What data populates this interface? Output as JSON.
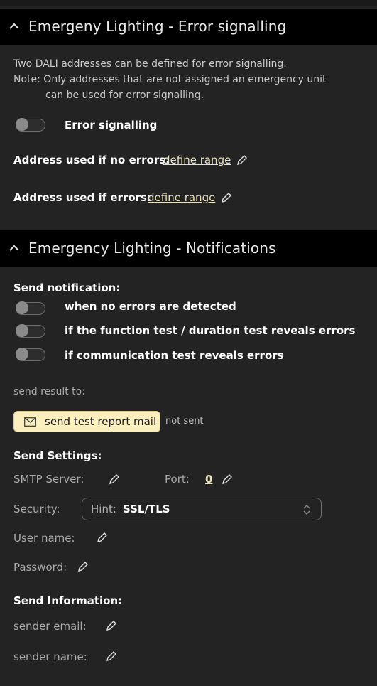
{
  "section1": {
    "title": "Emergeny Lighting - Error signalling",
    "desc_line1": "Two DALI addresses can be defined for error signalling.",
    "desc_line2": "Note: Only addresses that are not assigned an emergency unit",
    "desc_line3": "can be used for error signalling.",
    "toggle_label": "Error signalling",
    "addr_no_errors_label": "Address used if no errors:",
    "addr_no_errors_value": "define range",
    "addr_errors_label": "Address used if errors:",
    "addr_errors_value": "define range"
  },
  "section2": {
    "title": "Emergency Lighting -  Notifications",
    "send_notification_label": "Send notification:",
    "notify_options": [
      "when no errors are detected",
      "if the function test / duration test reveals errors",
      "if communication test reveals errors"
    ],
    "send_result_to": "send result to:",
    "mail_button": "send test report mail",
    "mail_status": "not sent",
    "send_settings_label": "Send Settings:",
    "smtp_server_label": "SMTP Server:",
    "port_label": "Port:",
    "port_value": "0",
    "security_label": "Security:",
    "security_hint": "Hint:",
    "security_value": "SSL/TLS",
    "username_label": "User name:",
    "password_label": "Password:",
    "send_info_label": "Send Information:",
    "sender_email_label": "sender email:",
    "sender_name_label": "sender name:"
  },
  "colors": {
    "background": "#232323",
    "header": "#000000",
    "button_bg": "#fbefc0",
    "link": "#e8e0c0"
  },
  "icons": [
    "chevron-up-icon",
    "pencil-icon",
    "mail-icon",
    "select-arrows-icon"
  ]
}
